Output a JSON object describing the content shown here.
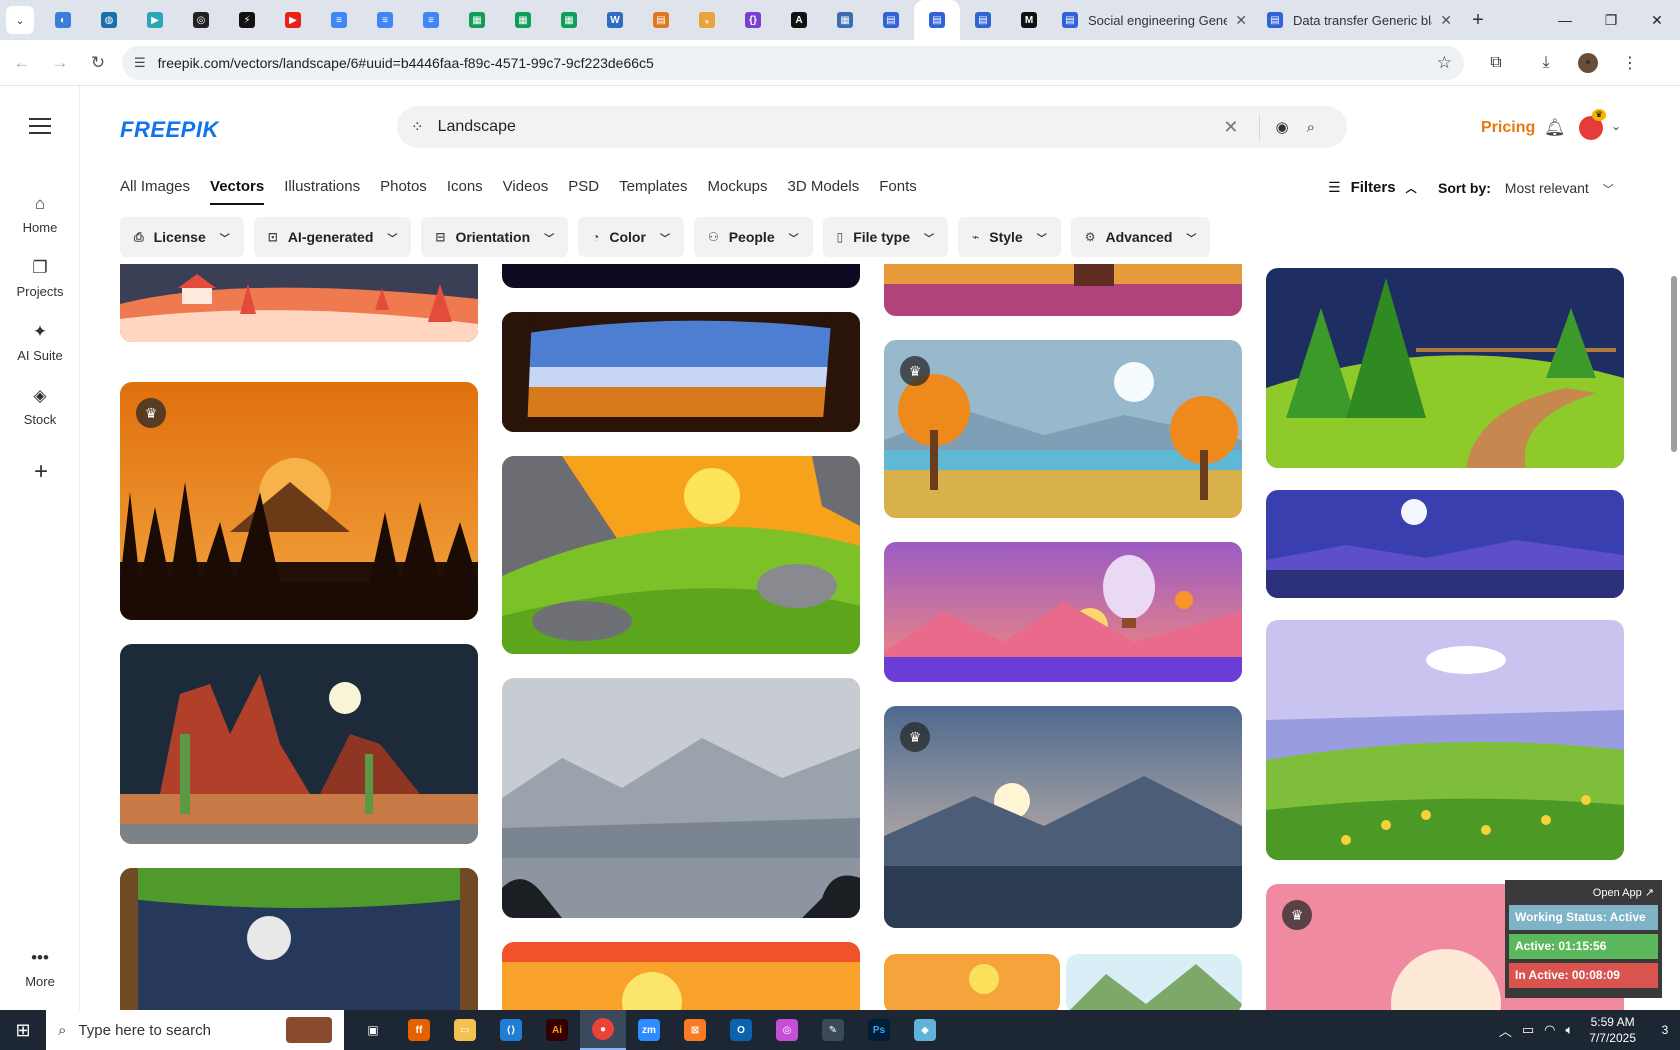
{
  "browser": {
    "pinned_tabs": [
      {
        "icon": "chrome-menu-icon"
      },
      {
        "icon": "edge-icon",
        "color": "#3b7dd8"
      },
      {
        "icon": "globe-icon",
        "color": "#1a6fa8"
      },
      {
        "icon": "play-icon",
        "color": "#2aa6b8"
      },
      {
        "icon": "circle-icon",
        "color": "#222222"
      },
      {
        "icon": "bolt-icon",
        "color": "#111111"
      },
      {
        "icon": "youtube-icon",
        "color": "#e62117"
      },
      {
        "icon": "doc-icon",
        "color": "#4285f4"
      },
      {
        "icon": "doc-icon",
        "color": "#4285f4"
      },
      {
        "icon": "doc-icon",
        "color": "#4285f4"
      },
      {
        "icon": "sheet-icon",
        "color": "#0f9d58"
      },
      {
        "icon": "sheet-icon",
        "color": "#0f9d58"
      },
      {
        "icon": "sheet-icon",
        "color": "#0f9d58"
      },
      {
        "icon": "word-icon",
        "color": "#2b6cc4"
      },
      {
        "icon": "slides-icon",
        "color": "#e0781f"
      },
      {
        "icon": "bird-icon",
        "color": "#e8a33a"
      },
      {
        "icon": "code-icon",
        "color": "#7a3fd1"
      },
      {
        "icon": "a-icon",
        "color": "#111111"
      },
      {
        "icon": "grid-icon",
        "color": "#3b6db0"
      },
      {
        "icon": "form-icon",
        "color": "#2f63d6"
      },
      {
        "icon": "form-icon",
        "color": "#2f63d6"
      },
      {
        "icon": "form-icon",
        "color": "#2f63d6"
      },
      {
        "icon": "m-icon",
        "color": "#111111"
      }
    ],
    "tabs": [
      {
        "title": "Social engineering Gener",
        "icon": "form-icon"
      },
      {
        "title": "Data transfer Generic bla",
        "icon": "form-icon"
      }
    ],
    "url": "freepik.com/vectors/landscape/6#uuid=b4446faa-f89c-4571-99c7-9cf223de66c5"
  },
  "rail": {
    "items": [
      {
        "label": "Home",
        "icon": "home-icon"
      },
      {
        "label": "Projects",
        "icon": "folder-icon"
      },
      {
        "label": "AI Suite",
        "icon": "sparkle-icon"
      },
      {
        "label": "Stock",
        "icon": "shapes-icon"
      },
      {
        "label": "More",
        "icon": "more-icon"
      }
    ]
  },
  "header": {
    "logo": "FREEPIK",
    "search_value": "Landscape",
    "pricing": "Pricing"
  },
  "categories": [
    "All Images",
    "Vectors",
    "Illustrations",
    "Photos",
    "Icons",
    "Videos",
    "PSD",
    "Templates",
    "Mockups",
    "3D Models",
    "Fonts"
  ],
  "active_category": "Vectors",
  "filters_label": "Filters",
  "sort": {
    "label": "Sort by:",
    "value": "Most relevant"
  },
  "chips": [
    {
      "label": "License",
      "icon": "license-icon"
    },
    {
      "label": "AI-generated",
      "icon": "ai-icon"
    },
    {
      "label": "Orientation",
      "icon": "orientation-icon"
    },
    {
      "label": "Color",
      "icon": "palette-icon"
    },
    {
      "label": "People",
      "icon": "people-icon"
    },
    {
      "label": "File type",
      "icon": "file-icon"
    },
    {
      "label": "Style",
      "icon": "brush-icon"
    },
    {
      "label": "Advanced",
      "icon": "gear-icon"
    }
  ],
  "status_widget": {
    "open_app": "Open App ↗",
    "working": "Working Status: Active",
    "active": "Active: 01:15:56",
    "inactive": "In Active: 00:08:09"
  },
  "taskbar": {
    "search_placeholder": "Type here to search",
    "time": "5:59 AM",
    "date": "7/7/2025",
    "notifications": "3"
  }
}
